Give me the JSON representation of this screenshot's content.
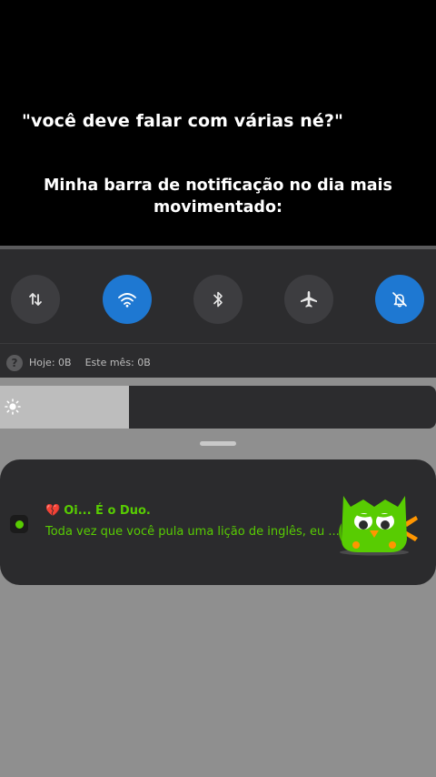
{
  "meme": {
    "caption_top": "\"você deve falar com várias né?\"",
    "caption_bottom": "Minha barra de notificação no dia mais movimentado:"
  },
  "quick_settings": {
    "toggles": [
      {
        "name": "mobile-data",
        "icon": "data-arrows-icon",
        "active": false
      },
      {
        "name": "wifi",
        "icon": "wifi-icon",
        "active": true
      },
      {
        "name": "bluetooth",
        "icon": "bluetooth-icon",
        "active": false
      },
      {
        "name": "airplane-mode",
        "icon": "airplane-icon",
        "active": false
      },
      {
        "name": "do-not-disturb",
        "icon": "bell-off-icon",
        "active": true
      }
    ],
    "data_usage": {
      "icon_glyph": "?",
      "today": "Hoje: 0B",
      "month": "Este mês: 0B"
    },
    "brightness": {
      "level": 0.295,
      "icon": "sun-icon"
    }
  },
  "notification": {
    "app_icon": "duolingo-icon",
    "heart_glyph": "💔",
    "title": "Oi... É o Duo.",
    "body": "Toda vez que você pula uma lição de inglês, eu ...",
    "image": "duo-owl-sad",
    "color": "#58cc02"
  },
  "colors": {
    "accent_blue": "#1e78d2",
    "duo_green": "#58cc02",
    "panel": "#2c2c2e"
  }
}
